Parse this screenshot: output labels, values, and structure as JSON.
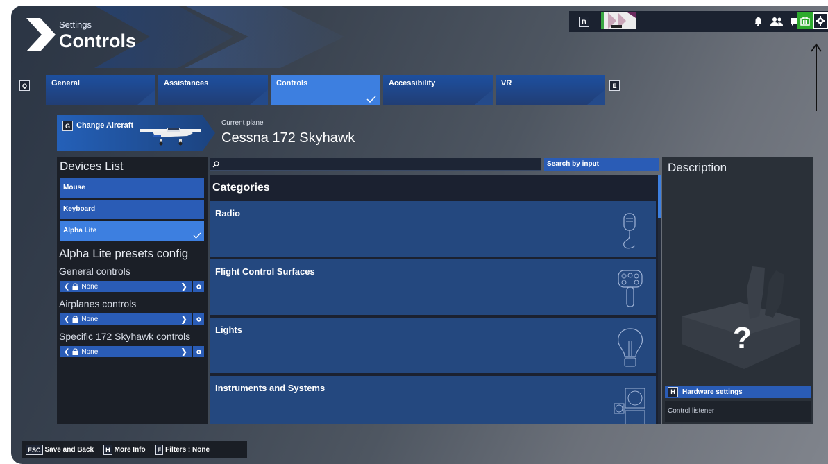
{
  "header": {
    "small_title": "Settings",
    "big_title": "Controls"
  },
  "topbar": {
    "key_b": "B",
    "icons": [
      "bell-icon",
      "friends-icon",
      "chat-icon",
      "store-icon",
      "gear-icon"
    ]
  },
  "tabs": {
    "prev_key": "Q",
    "next_key": "E",
    "items": [
      {
        "label": "General",
        "active": false
      },
      {
        "label": "Assistances",
        "active": false
      },
      {
        "label": "Controls",
        "active": true
      },
      {
        "label": "Accessibility",
        "active": false
      },
      {
        "label": "VR",
        "active": false
      }
    ]
  },
  "aircraft": {
    "change_key": "G",
    "change_label": "Change Aircraft",
    "current_label": "Current plane",
    "current_name": "Cessna 172 Skyhawk"
  },
  "devices": {
    "title": "Devices List",
    "items": [
      {
        "label": "Mouse",
        "selected": false
      },
      {
        "label": "Keyboard",
        "selected": false
      },
      {
        "label": "Alpha Lite",
        "selected": true
      }
    ],
    "presets_title": "Alpha Lite presets config",
    "presets": [
      {
        "label": "General controls",
        "value": "None"
      },
      {
        "label": "Airplanes controls",
        "value": "None"
      },
      {
        "label": "Specific 172 Skyhawk controls",
        "value": "None"
      }
    ]
  },
  "search": {
    "button_label": "Search by input"
  },
  "categories": {
    "title": "Categories",
    "items": [
      {
        "label": "Radio",
        "icon": "microphone-icon"
      },
      {
        "label": "Flight Control Surfaces",
        "icon": "yoke-icon"
      },
      {
        "label": "Lights",
        "icon": "lightbulb-icon"
      },
      {
        "label": "Instruments and Systems",
        "icon": "instruments-icon"
      }
    ]
  },
  "description": {
    "title": "Description",
    "placeholder": "?",
    "hardware_key": "H",
    "hardware_label": "Hardware settings",
    "listener_label": "Control listener"
  },
  "footer": {
    "items": [
      {
        "key": "ESC",
        "label": "Save and Back"
      },
      {
        "key": "H",
        "label": "More Info"
      },
      {
        "key": "F",
        "label": "Filters : None"
      }
    ]
  },
  "colors": {
    "accent": "#3d7fe0",
    "tab_bg": "#1d4f9f",
    "store_green": "#2eab2e"
  }
}
